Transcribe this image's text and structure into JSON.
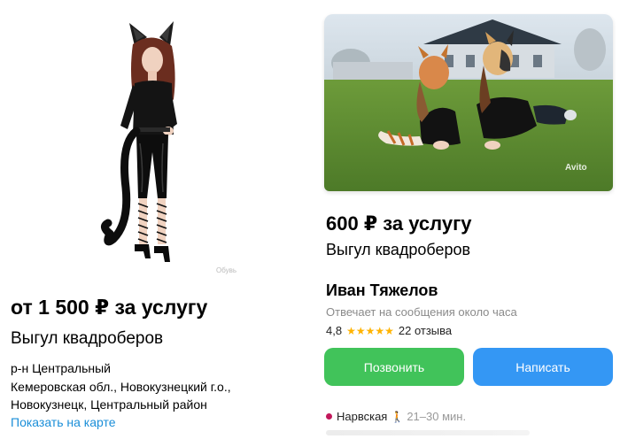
{
  "left_listing": {
    "price": "от 1 500 ₽ за услугу",
    "title": "Выгул квадроберов",
    "address_line1": "р-н Центральный",
    "address_line2": "Кемеровская обл., Новокузнецкий г.о.,",
    "address_line3": "Новокузнецк, Центральный район",
    "map_link": "Показать на карте",
    "photo_watermark": "Обувь"
  },
  "right_listing": {
    "photo_watermark": "Avito",
    "price": "600 ₽ за услугу",
    "title": "Выгул квадроберов",
    "seller_name": "Иван Тяжелов",
    "response_time": "Отвечает на сообщения около часа",
    "rating": "4,8",
    "stars": "★★★★★",
    "reviews": "22 отзыва",
    "call_button": "Позвонить",
    "write_button": "Написать",
    "metro_station": "Нарвская",
    "metro_time": "21–30 мин.",
    "colors": {
      "call": "#41c35a",
      "write": "#3497f4",
      "link": "#1a8ed8",
      "metro": "#c2185b",
      "stars": "#ffb300"
    }
  }
}
